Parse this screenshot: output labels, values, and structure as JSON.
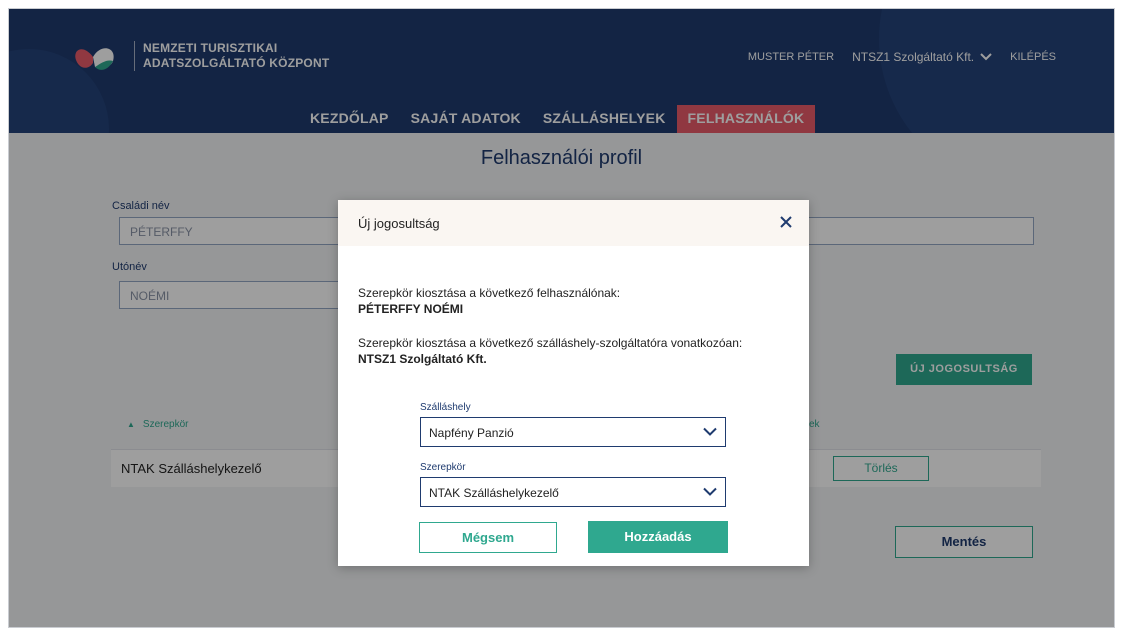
{
  "header": {
    "logo_line1": "NEMZETI TURISZTIKAI",
    "logo_line2": "ADATSZOLGÁLTATÓ KÖZPONT",
    "user_name": "MUSTER PÉTER",
    "company": "NTSZ1 Szolgáltató Kft.",
    "logout": "KILÉPÉS",
    "nav": [
      {
        "label": "KEZDŐLAP"
      },
      {
        "label": "SAJÁT ADATOK"
      },
      {
        "label": "SZÁLLÁSHELYEK"
      },
      {
        "label": "FELHASZNÁLÓK"
      }
    ],
    "colors": {
      "header_bg": "#1f3b6f",
      "active_tab": "#e85b6a"
    }
  },
  "page": {
    "title": "Felhasználói profil",
    "family_name_label": "Családi név",
    "family_name_value": "PÉTERFFY",
    "given_name_label": "Utónév",
    "given_name_value": "NOÉMI",
    "new_permission_button": "ÚJ JOGOSULTSÁG",
    "table": {
      "col_role": "Szerepkör",
      "col_actions_partial": "ek",
      "rows": [
        {
          "role": "NTAK Szálláshelykezelő",
          "delete": "Törlés"
        }
      ]
    },
    "save_button": "Mentés"
  },
  "modal": {
    "title": "Új jogosultság",
    "user_intro": "Szerepkör kiosztása a következő felhasználónak:",
    "user_name": "PÉTERFFY NOÉMI",
    "provider_intro": "Szerepkör kiosztása a következő szálláshely-szolgáltatóra vonatkozóan:",
    "provider_name": "NTSZ1 Szolgáltató Kft.",
    "accommodation_label": "Szálláshely",
    "accommodation_value": "Napfény Panzió",
    "role_label": "Szerepkör",
    "role_value": "NTAK Szálláshelykezelő",
    "cancel_button": "Mégsem",
    "add_button": "Hozzáadás",
    "accent_color": "#2fa88f"
  }
}
